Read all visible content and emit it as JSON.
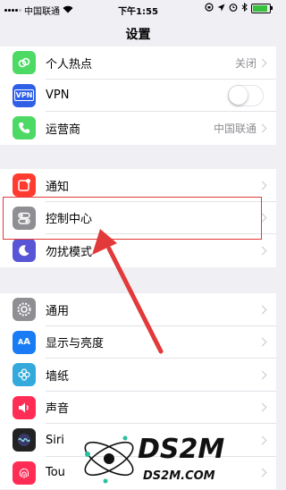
{
  "status_bar": {
    "carrier": "中国联通",
    "time": "下午1:55",
    "battery_level": 0.9,
    "accent_green": "#36c23c"
  },
  "header": {
    "title": "设置"
  },
  "groups": [
    {
      "items": [
        {
          "label": "个人热点",
          "value": "关闭",
          "icon": "hotspot-icon",
          "color": "#4cd964"
        },
        {
          "label": "VPN",
          "icon": "vpn-icon",
          "color": "#2f5fe6",
          "toggle": false
        },
        {
          "label": "运营商",
          "value": "中国联通",
          "icon": "phone-icon",
          "color": "#4cd964"
        }
      ]
    },
    {
      "items": [
        {
          "label": "通知",
          "icon": "notifications-icon",
          "color": "#ff3b30"
        },
        {
          "label": "控制中心",
          "icon": "control-center-icon",
          "color": "#8e8e93"
        },
        {
          "label": "勿扰模式",
          "icon": "moon-icon",
          "color": "#5856d6"
        }
      ]
    },
    {
      "items": [
        {
          "label": "通用",
          "icon": "gear-icon",
          "color": "#8e8e93"
        },
        {
          "label": "显示与亮度",
          "icon": "display-icon",
          "color": "#1a7cf5"
        },
        {
          "label": "墙纸",
          "icon": "wallpaper-icon",
          "color": "#34aadc"
        },
        {
          "label": "声音",
          "icon": "sound-icon",
          "color": "#ff2d55"
        },
        {
          "label": "Siri",
          "icon": "siri-icon",
          "color": "#222222"
        },
        {
          "label": "Tou",
          "icon": "fingerprint-icon",
          "color": "#ff2d55"
        }
      ]
    }
  ],
  "annotation": {
    "color": "#e23a3a"
  },
  "watermark": {
    "brand": "DS2M",
    "url": "DS2M.COM"
  }
}
